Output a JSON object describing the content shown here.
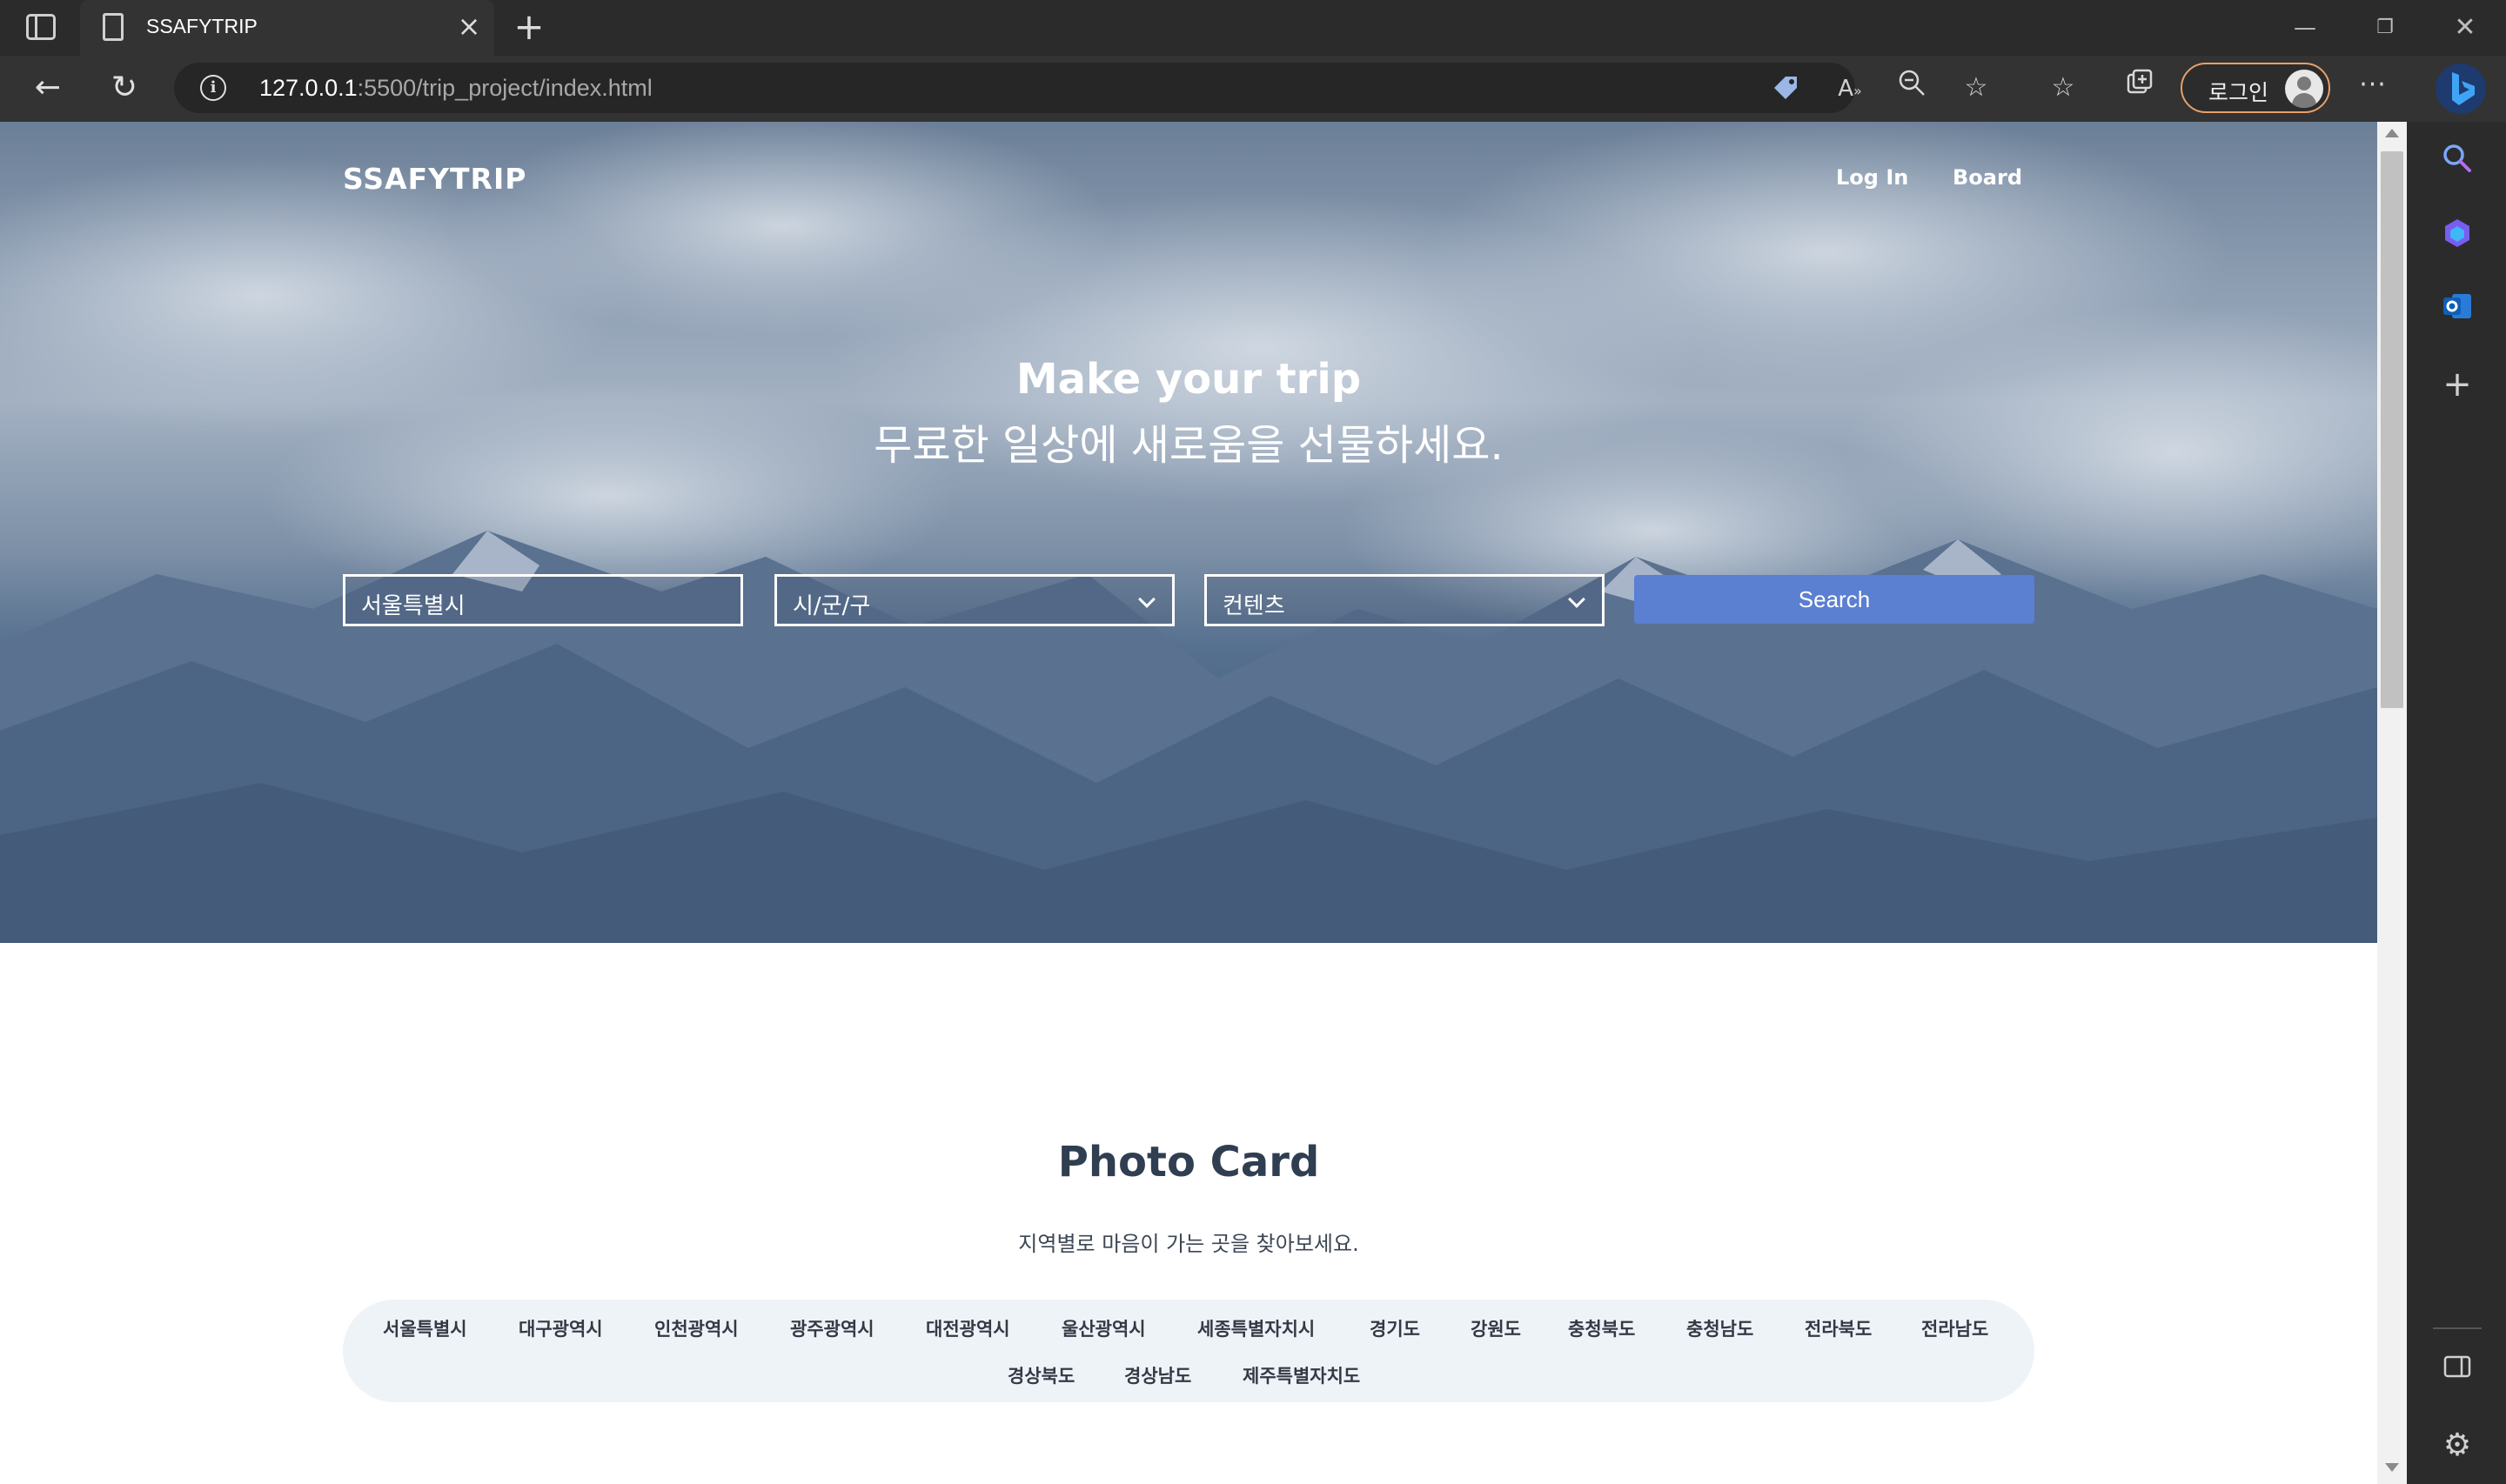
{
  "browser": {
    "tab_title": "SSAFYTRIP",
    "url_host": "127.0.0.1",
    "url_rest": ":5500/trip_project/index.html",
    "profile_label": "로그인",
    "window_controls": [
      "minimize-icon",
      "restore-icon",
      "close-icon"
    ],
    "toolbar_icons": [
      "coupon-tag-icon",
      "read-aloud-icon",
      "zoom-out-icon",
      "add-favorite-icon",
      "favorites-icon",
      "collections-icon",
      "more-icon"
    ],
    "sidebar_icons": [
      "search-icon",
      "copilot-icon",
      "outlook-icon",
      "add-icon",
      "sidebar-toggle-icon",
      "settings-icon"
    ]
  },
  "site": {
    "brand": "SSAFYTRIP",
    "nav": [
      "Log In",
      "Board"
    ],
    "hero_title": "Make your trip",
    "hero_subtitle": "무료한 일상에 새로움을 선물하세요.",
    "search": {
      "province_value": "서울특별시",
      "district_value": "시/군/구",
      "content_value": "컨텐츠",
      "button_label": "Search"
    },
    "section_title": "Photo Card",
    "section_desc": "지역별로 마음이 가는 곳을 찾아보세요.",
    "regions": [
      "서울특별시",
      "대구광역시",
      "인천광역시",
      "광주광역시",
      "대전광역시",
      "울산광역시",
      "세종특별자치시",
      "경기도",
      "강원도",
      "충청북도",
      "충청남도",
      "전라북도",
      "전라남도",
      "경상북도",
      "경상남도",
      "제주특별자치도"
    ]
  },
  "colors": {
    "accent": "#5b7fd1",
    "hero_overlay": "#4a6383",
    "profile_border": "#e8a06a"
  }
}
